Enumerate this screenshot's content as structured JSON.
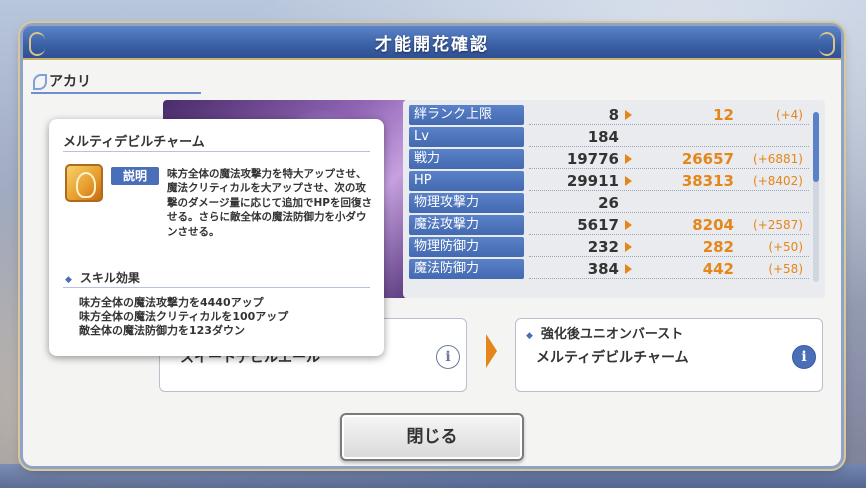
{
  "dialog": {
    "title": "才能開花確認",
    "character_name": "アカリ",
    "close_label": "閉じる"
  },
  "stats": [
    {
      "label": "絆ランク上限",
      "value": "8",
      "new": "12",
      "diff": "(+4)"
    },
    {
      "label": "Lv",
      "value": "184",
      "new": "",
      "diff": ""
    },
    {
      "label": "戦力",
      "value": "19776",
      "new": "26657",
      "diff": "(+6881)"
    },
    {
      "label": "HP",
      "value": "29911",
      "new": "38313",
      "diff": "(+8402)"
    },
    {
      "label": "物理攻撃力",
      "value": "26",
      "new": "",
      "diff": ""
    },
    {
      "label": "魔法攻撃力",
      "value": "5617",
      "new": "8204",
      "diff": "(+2587)"
    },
    {
      "label": "物理防御力",
      "value": "232",
      "new": "282",
      "diff": "(+50)"
    },
    {
      "label": "魔法防御力",
      "value": "384",
      "new": "442",
      "diff": "(+58)"
    }
  ],
  "ub": {
    "left_name": "スイートデビルエール",
    "right_heading": "強化後ユニオンバースト",
    "right_name": "メルティデビルチャーム",
    "info_glyph": "i"
  },
  "tooltip": {
    "title": "メルティデビルチャーム",
    "desc_tag": "説明",
    "description": "味方全体の魔法攻撃力を特大アップさせ、魔法クリティカルを大アップさせ、次の攻撃のダメージ量に応じて追加でHPを回復させる。さらに敵全体の魔法防御力を小ダウンさせる。",
    "effect_heading": "スキル効果",
    "effects": [
      "味方全体の魔法攻撃力を4440アップ",
      "味方全体の魔法クリティカルを100アップ",
      "敵全体の魔法防御力を123ダウン"
    ]
  },
  "colors": {
    "header_blue": "#3d62a8",
    "label_blue": "#4a6fb8",
    "accent_orange": "#e5861a"
  }
}
